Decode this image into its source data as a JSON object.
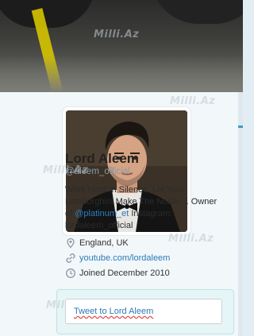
{
  "profile": {
    "name": "Lord Aleem",
    "handle": "@aleem_official",
    "bio_part1": "Work Hard In Silence. Let Your Lamborghini Make The Noise.... Owner of ",
    "bio_mention": "@platinum_et",
    "bio_part2": " Instagram: lordaleem_official",
    "location": "England, UK",
    "website": "youtube.com/lordaleem",
    "joined": "Joined December 2010",
    "tweet_to_placeholder": "Tweet to Lord Aleem"
  },
  "watermark": "Milli.Az",
  "icons": {
    "location": "location-pin-icon",
    "website": "link-icon",
    "joined": "calendar-clock-icon"
  },
  "colors": {
    "link": "#2b7bb9",
    "card_background": "#f2f7fa",
    "tweet_box_background": "#e6f5f5"
  }
}
